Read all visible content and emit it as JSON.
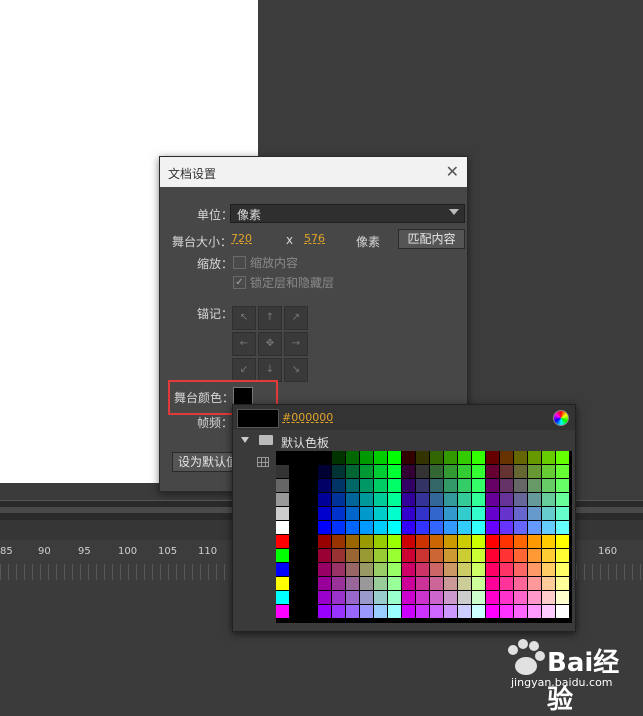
{
  "dialog": {
    "title": "文档设置",
    "close": "✕",
    "unit_label": "单位：",
    "unit_value": "像素",
    "stage_size_label": "舞台大小：",
    "width": "720",
    "x": "x",
    "height": "576",
    "size_unit": "像素",
    "match_button": "匹配内容",
    "scale_label": "缩放：",
    "scale_content": "缩放内容",
    "lock_layers": "锁定层和隐藏层",
    "anchor_label": "锚记：",
    "anchor_glyphs": [
      "↖",
      "↑",
      "↗",
      "←",
      "✥",
      "→",
      "↙",
      "↓",
      "↘"
    ],
    "stage_color_label": "舞台颜色：",
    "fps_label": "帧频：",
    "default_button": "设为默认值"
  },
  "color_popup": {
    "hex": "#000000",
    "folder_label": "默认色板",
    "current_color": "#000000"
  },
  "timeline": {
    "numbers": [
      "85",
      "90",
      "95",
      "100",
      "105",
      "110",
      "160"
    ]
  },
  "watermark": {
    "brand": "Bai经验",
    "domain": "jingyan.baidu.com"
  }
}
